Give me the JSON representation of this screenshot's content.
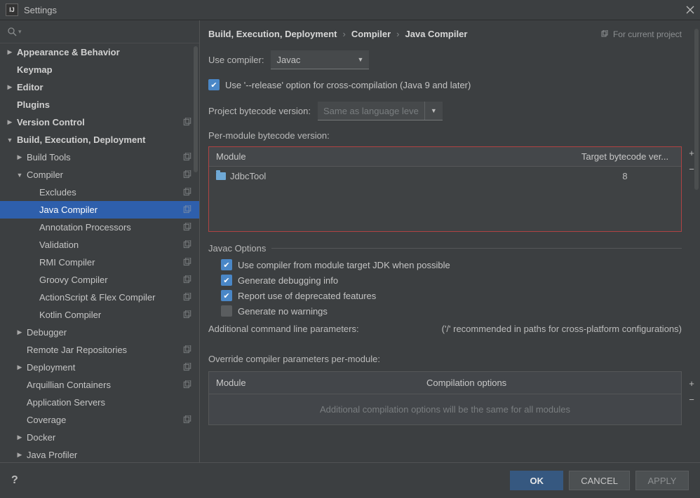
{
  "title": "Settings",
  "breadcrumb": {
    "root": "Build, Execution, Deployment",
    "mid": "Compiler",
    "leaf": "Java Compiler",
    "tag": "For current project"
  },
  "sidebar": {
    "items": [
      {
        "label": "Appearance & Behavior",
        "lvl": 0,
        "exp": "▶",
        "bold": true
      },
      {
        "label": "Keymap",
        "lvl": 0,
        "exp": "",
        "bold": true
      },
      {
        "label": "Editor",
        "lvl": 0,
        "exp": "▶",
        "bold": true
      },
      {
        "label": "Plugins",
        "lvl": 0,
        "exp": "",
        "bold": true
      },
      {
        "label": "Version Control",
        "lvl": 0,
        "exp": "▶",
        "bold": true,
        "badge": true
      },
      {
        "label": "Build, Execution, Deployment",
        "lvl": 0,
        "exp": "▼",
        "bold": true
      },
      {
        "label": "Build Tools",
        "lvl": 1,
        "exp": "▶",
        "badge": true
      },
      {
        "label": "Compiler",
        "lvl": 1,
        "exp": "▼",
        "badge": true
      },
      {
        "label": "Excludes",
        "lvl": 2,
        "exp": "",
        "badge": true
      },
      {
        "label": "Java Compiler",
        "lvl": 2,
        "exp": "",
        "badge": true,
        "sel": true
      },
      {
        "label": "Annotation Processors",
        "lvl": 2,
        "exp": "",
        "badge": true
      },
      {
        "label": "Validation",
        "lvl": 2,
        "exp": "",
        "badge": true
      },
      {
        "label": "RMI Compiler",
        "lvl": 2,
        "exp": "",
        "badge": true
      },
      {
        "label": "Groovy Compiler",
        "lvl": 2,
        "exp": "",
        "badge": true
      },
      {
        "label": "ActionScript & Flex Compiler",
        "lvl": 2,
        "exp": "",
        "badge": true
      },
      {
        "label": "Kotlin Compiler",
        "lvl": 2,
        "exp": "",
        "badge": true
      },
      {
        "label": "Debugger",
        "lvl": 1,
        "exp": "▶"
      },
      {
        "label": "Remote Jar Repositories",
        "lvl": 1,
        "exp": "",
        "badge": true
      },
      {
        "label": "Deployment",
        "lvl": 1,
        "exp": "▶",
        "badge": true
      },
      {
        "label": "Arquillian Containers",
        "lvl": 1,
        "exp": "",
        "badge": true
      },
      {
        "label": "Application Servers",
        "lvl": 1,
        "exp": ""
      },
      {
        "label": "Coverage",
        "lvl": 1,
        "exp": "",
        "badge": true
      },
      {
        "label": "Docker",
        "lvl": 1,
        "exp": "▶"
      },
      {
        "label": "Java Profiler",
        "lvl": 1,
        "exp": "▶"
      }
    ]
  },
  "form": {
    "use_compiler_label": "Use compiler:",
    "use_compiler_value": "Javac",
    "release_opt": "Use '--release' option for cross-compilation (Java 9 and later)",
    "byte_ver_label": "Project bytecode version:",
    "byte_ver_placeholder": "Same as language leve",
    "per_module_label": "Per-module bytecode version:",
    "module_head": "Module",
    "target_head": "Target bytecode ver...",
    "module_rows": [
      {
        "name": "JdbcTool",
        "target": "8"
      }
    ],
    "javac_title": "Javac Options",
    "opt1": "Use compiler from module target JDK when possible",
    "opt2": "Generate debugging info",
    "opt3": "Report use of deprecated features",
    "opt4": "Generate no warnings",
    "params_label": "Additional command line parameters:",
    "params_hint": "('/' recommended in paths for cross-platform configurations)",
    "override_label": "Override compiler parameters per-module:",
    "over_head1": "Module",
    "over_head2": "Compilation options",
    "over_placeholder": "Additional compilation options will be the same for all modules"
  },
  "footer": {
    "ok": "OK",
    "cancel": "CANCEL",
    "apply": "APPLY"
  }
}
